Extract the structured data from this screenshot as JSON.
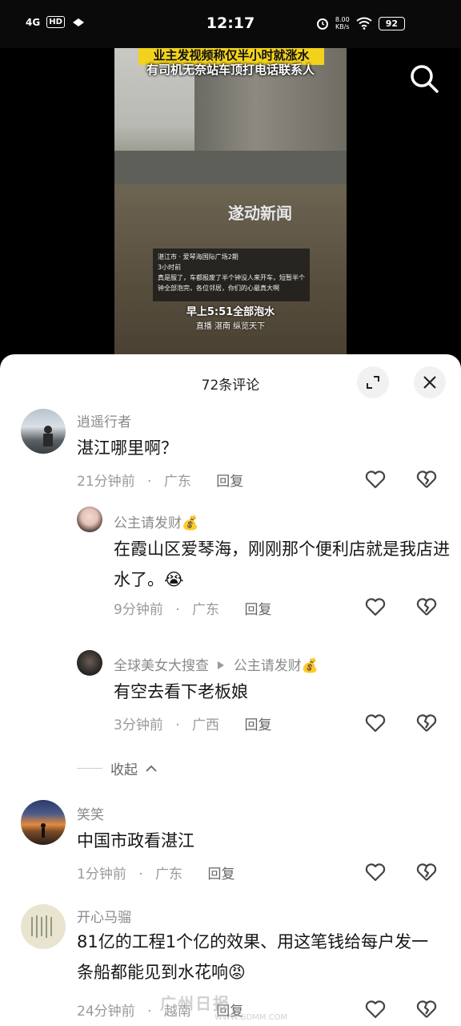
{
  "status_bar": {
    "network": "4G",
    "hd": "HD",
    "time": "12:17",
    "speed_value": "8.00",
    "speed_unit": "KB/s",
    "battery": "92"
  },
  "video": {
    "caption_top": "业主发视频称仅半小时就涨水",
    "caption_sub": "有司机无奈站车顶打电话联系人",
    "watermark": "遂动新闻",
    "location": "湛江市 · 爱琴海国际广场2期",
    "card_time": "3小时前",
    "card_text": "真是服了，车都报废了半个钟没人来开车，短暂半个钟全部泡完，各位邻居，你们的心最真大啊",
    "caption_bottom": "早上5:51全部泡水",
    "caption_footer": "直播 湛南 纵览天下"
  },
  "sheet": {
    "title": "72条评论"
  },
  "comments": [
    {
      "author": "逍遥行者",
      "text": "湛江哪里啊？",
      "time": "21分钟前",
      "region": "广东",
      "reply": "回复"
    },
    {
      "author": "公主请发财💰",
      "text": "在霞山区爱琴海，刚刚那个便利店就是我店进水了。😭",
      "time": "9分钟前",
      "region": "广东",
      "reply": "回复"
    },
    {
      "author": "全球美女大搜查",
      "reply_to": "公主请发财💰",
      "text": "有空去看下老板娘",
      "time": "3分钟前",
      "region": "广西",
      "reply": "回复"
    },
    {
      "author": "笑笑",
      "text": "中国市政看湛江",
      "time": "1分钟前",
      "region": "广东",
      "reply": "回复"
    },
    {
      "author": "开心马骝",
      "text": "81亿的工程1个亿的效果、用这笔钱给每户发一条船都能见到水花响😡",
      "time": "24分钟前",
      "region": "越南",
      "reply": "回复"
    }
  ],
  "collapse_label": "收起",
  "separator": "·",
  "bottom_watermark": "广州日报",
  "bottom_watermark_url": "WWW.GDMM.COM"
}
